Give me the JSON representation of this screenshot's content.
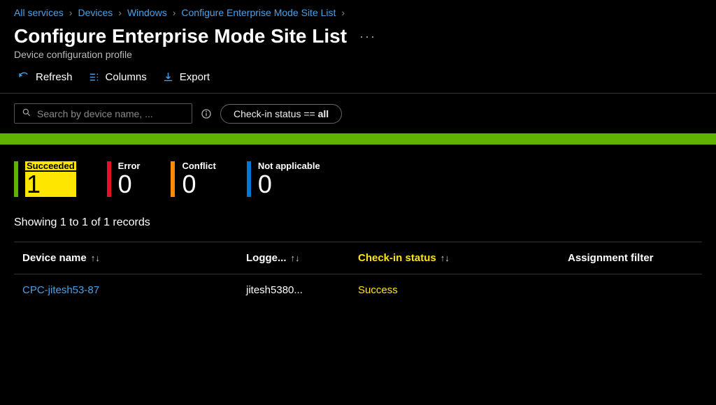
{
  "breadcrumb": {
    "items": [
      "All services",
      "Devices",
      "Windows",
      "Configure Enterprise Mode Site List"
    ]
  },
  "page": {
    "title": "Configure Enterprise Mode Site List",
    "subtitle": "Device configuration profile"
  },
  "toolbar": {
    "refresh": "Refresh",
    "columns": "Columns",
    "export": "Export"
  },
  "search": {
    "placeholder": "Search by device name, ..."
  },
  "filter": {
    "label": "Check-in status == ",
    "value": "all"
  },
  "status": {
    "succeeded": {
      "label": "Succeeded",
      "value": "1",
      "color": "#5db300"
    },
    "error": {
      "label": "Error",
      "value": "0",
      "color": "#e81123"
    },
    "conflict": {
      "label": "Conflict",
      "value": "0",
      "color": "#ff8c00"
    },
    "not_applicable": {
      "label": "Not applicable",
      "value": "0",
      "color": "#0078d4"
    }
  },
  "records_text": "Showing 1 to 1 of 1 records",
  "table": {
    "headers": {
      "device": "Device name",
      "logged": "Logge...",
      "checkin": "Check-in status",
      "assignment": "Assignment filter"
    },
    "rows": [
      {
        "device": "CPC-jitesh53-87",
        "logged": "jitesh5380...",
        "checkin": "Success",
        "assignment": ""
      }
    ]
  }
}
